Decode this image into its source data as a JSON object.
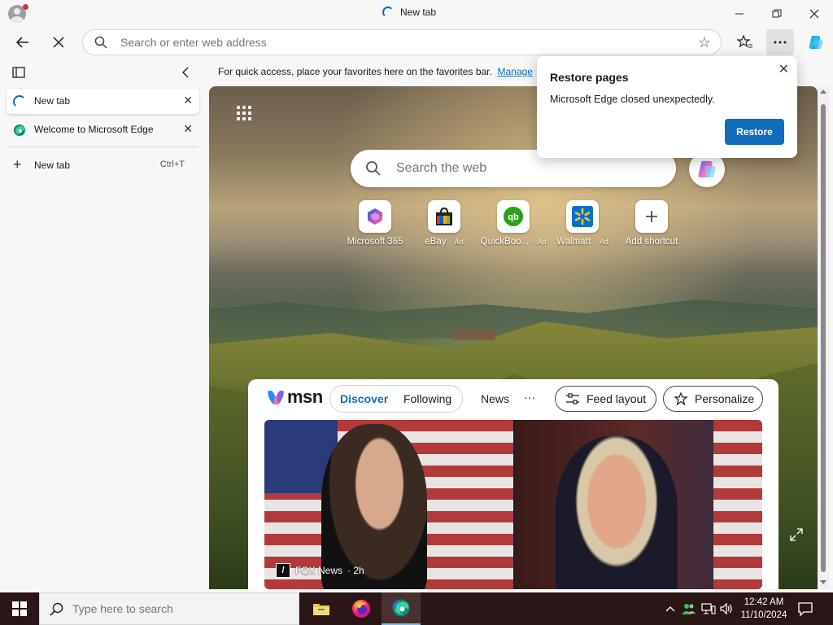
{
  "window": {
    "title": "New tab",
    "controls": {
      "minimize": "—",
      "maximize": "▢",
      "close": "✕"
    }
  },
  "toolbar": {
    "address_placeholder": "Search or enter web address"
  },
  "sidebar": {
    "tabs": [
      {
        "label": "New tab",
        "active": true
      },
      {
        "label": "Welcome to Microsoft Edge",
        "active": false
      }
    ],
    "new_tab_label": "New tab",
    "new_tab_shortcut": "Ctrl+T"
  },
  "favorites_bar": {
    "message": "For quick access, place your favorites here on the favorites bar.",
    "link": "Manage"
  },
  "new_tab_page": {
    "search_placeholder": "Search the web",
    "shortcuts": [
      {
        "label": "Microsoft 365",
        "ad": ""
      },
      {
        "label": "eBay",
        "ad": "Ad"
      },
      {
        "label": "QuickBoo...",
        "ad": "Ad"
      },
      {
        "label": "Walmart",
        "ad": "Ad"
      },
      {
        "label": "Add shortcut",
        "ad": ""
      }
    ]
  },
  "feed": {
    "brand": "msn",
    "tabs": [
      {
        "label": "Discover",
        "active": true
      },
      {
        "label": "Following",
        "active": false
      }
    ],
    "news_label": "News",
    "more_label": "···",
    "feed_layout_label": "Feed layout",
    "personalize_label": "Personalize",
    "card": {
      "source": "FOX News",
      "age": "· 2h"
    }
  },
  "popup": {
    "title": "Restore pages",
    "message": "Microsoft Edge closed unexpectedly.",
    "button": "Restore"
  },
  "taskbar": {
    "search_placeholder": "Type here to search",
    "time": "12:42 AM",
    "date": "11/10/2024"
  },
  "colors": {
    "accent": "#0f6cbd",
    "taskbar_bg": "#2a1616"
  }
}
